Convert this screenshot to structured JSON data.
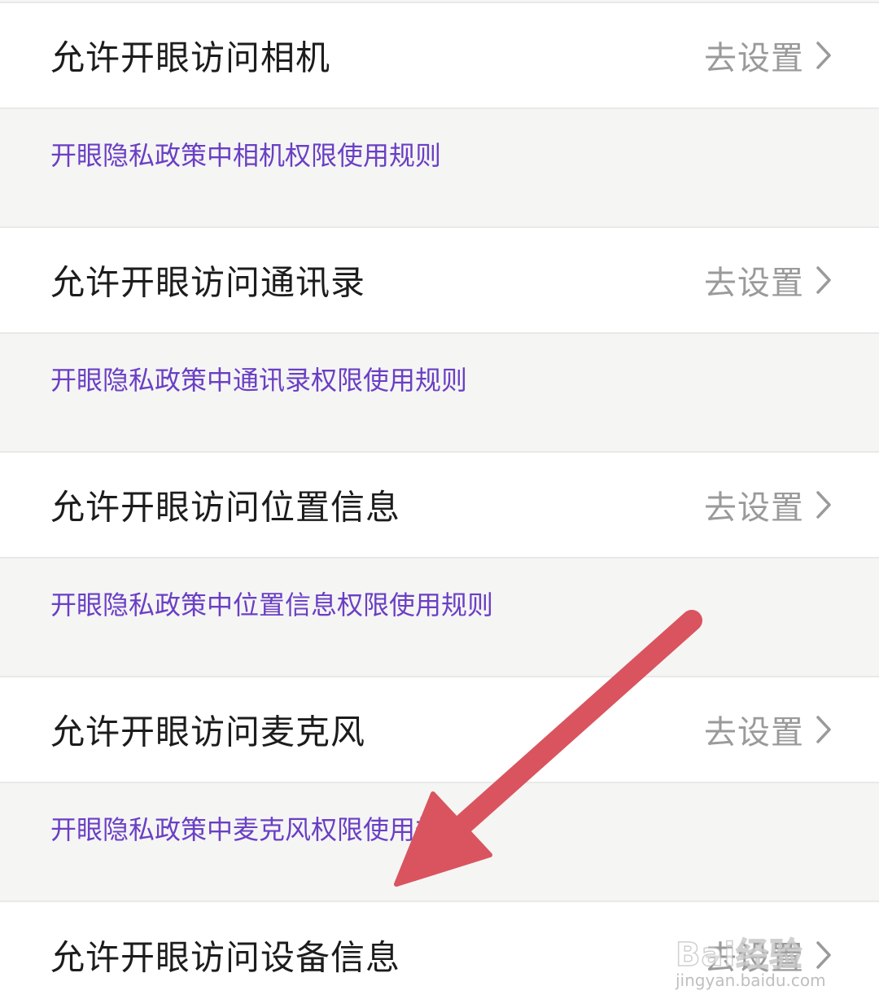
{
  "settings": [
    {
      "title": "允许开眼访问相机",
      "action": "去设置",
      "policy": "开眼隐私政策中相机权限使用规则"
    },
    {
      "title": "允许开眼访问通讯录",
      "action": "去设置",
      "policy": "开眼隐私政策中通讯录权限使用规则"
    },
    {
      "title": "允许开眼访问位置信息",
      "action": "去设置",
      "policy": "开眼隐私政策中位置信息权限使用规则"
    },
    {
      "title": "允许开眼访问麦克风",
      "action": "去设置",
      "policy": "开眼隐私政策中麦克风权限使用规则"
    },
    {
      "title": "允许开眼访问设备信息",
      "action": "去设置"
    }
  ],
  "annotation": {
    "arrow_color": "#d9545e"
  },
  "watermark": {
    "brand": "Bai经验",
    "url": "jingyan.baidu.com"
  },
  "colors": {
    "policy_link": "#6a3fc4",
    "action_text": "#9a9a9a",
    "title_text": "#1c1c1c",
    "section_bg": "#f5f5f4"
  }
}
